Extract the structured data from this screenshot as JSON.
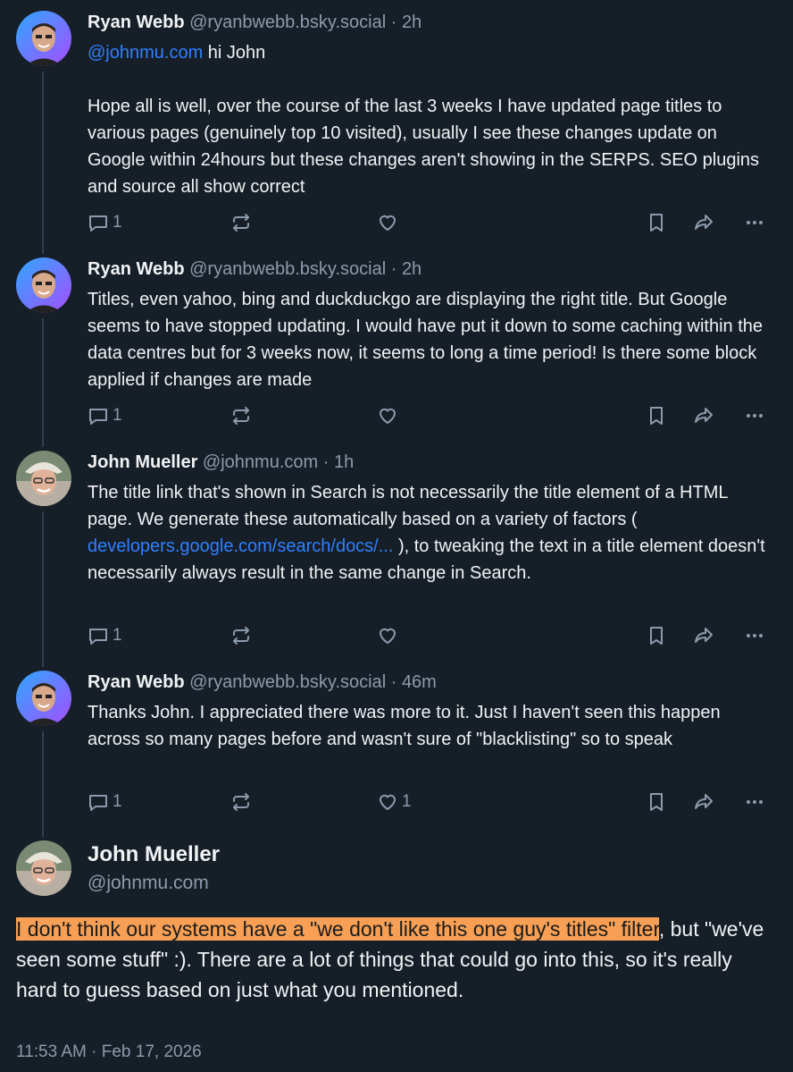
{
  "posts": [
    {
      "author": "Ryan Webb",
      "handle": "@ryanbwebb.bsky.social",
      "time": "2h",
      "mention": "@johnmu.com",
      "greeting": " hi John",
      "text": "Hope all is well, over the course of the last 3 weeks I have updated page titles to various pages (genuinely top 10 visited), usually I see these changes update on Google within 24hours but these changes aren't showing in the SERPS. SEO plugins and source all show correct",
      "reply_count": "1",
      "like_count": ""
    },
    {
      "author": "Ryan Webb",
      "handle": "@ryanbwebb.bsky.social",
      "time": "2h",
      "text": "Titles, even yahoo, bing and duckduckgo are displaying the right title. But Google seems to have stopped updating. I would have put it down to some caching within the data centres but for 3 weeks now, it seems to long a time period! Is there some block applied if changes are made",
      "reply_count": "1",
      "like_count": ""
    },
    {
      "author": "John Mueller",
      "handle": "@johnmu.com",
      "time": "1h",
      "text_before": "The title link that's shown in Search is not necessarily the title element of a HTML page. We generate these automatically based on a variety of factors ( ",
      "link": "developers.google.com/search/docs/...",
      "text_after": " ), to tweaking the text in a title element doesn't necessarily always result in the same change in Search.",
      "reply_count": "1",
      "like_count": ""
    },
    {
      "author": "Ryan Webb",
      "handle": "@ryanbwebb.bsky.social",
      "time": "46m",
      "text": "Thanks John. I appreciated there was more to it. Just I haven't seen this happen across so many pages before and wasn't sure of \"blacklisting\" so to speak",
      "reply_count": "1",
      "like_count": "1"
    }
  ],
  "main_post": {
    "author": "John Mueller",
    "handle": "@johnmu.com",
    "highlighted_text": "I don't think our systems have a \"we don't like this one guy's titles\" filter",
    "text": ", but \"we've seen some stuff\" :). There are a lot of things that could go into this, so it's really hard to guess based on just what you mentioned.",
    "timestamp": "11:53 AM · Feb 17, 2026"
  },
  "separator": "·",
  "icons": [
    "reply-icon",
    "repost-icon",
    "like-icon",
    "bookmark-icon",
    "share-icon",
    "more-icon"
  ],
  "colors": {
    "background": "#161e27",
    "muted": "#8c9bab",
    "link": "#2f80ff",
    "highlight": "#f7a055",
    "thread_line": "#2e4052"
  }
}
